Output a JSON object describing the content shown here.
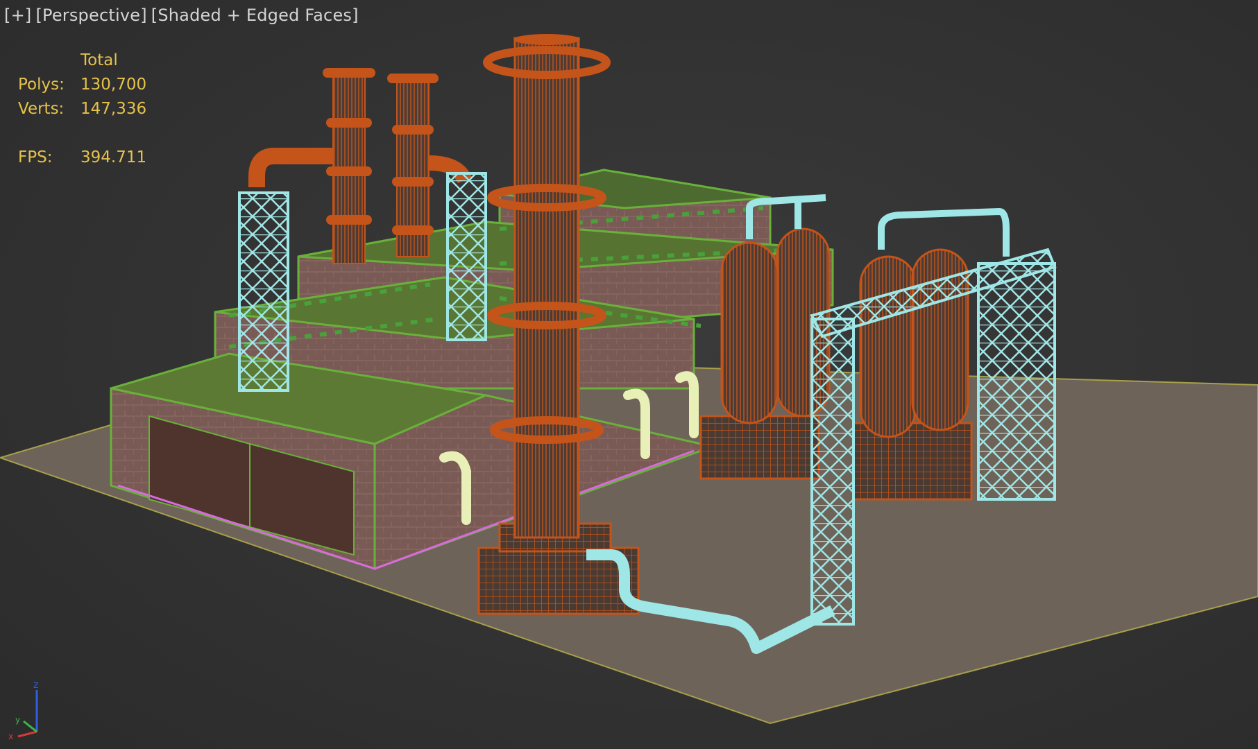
{
  "viewport": {
    "labels": {
      "menu": "[+]",
      "view": "[Perspective]",
      "shading": "[Shaded + Edged Faces]"
    },
    "stats": {
      "column_header": "Total",
      "polys_label": "Polys:",
      "polys_value": "130,700",
      "verts_label": "Verts:",
      "verts_value": "147,336",
      "fps_label": "FPS:",
      "fps_value": "394.711"
    },
    "axis_labels": {
      "z": "z",
      "x": "x",
      "y": "y"
    }
  },
  "colors": {
    "background": "#333333",
    "stats_text": "#e6c24a",
    "label_text": "#d4d4d4",
    "ground": "#6e6359",
    "orange_wire": "#c4541a",
    "cyan_wire": "#9fe6e6",
    "green_edges": "#69b13a",
    "brick": "#7a5a55",
    "pale_pipes": "#e8f0b8"
  }
}
